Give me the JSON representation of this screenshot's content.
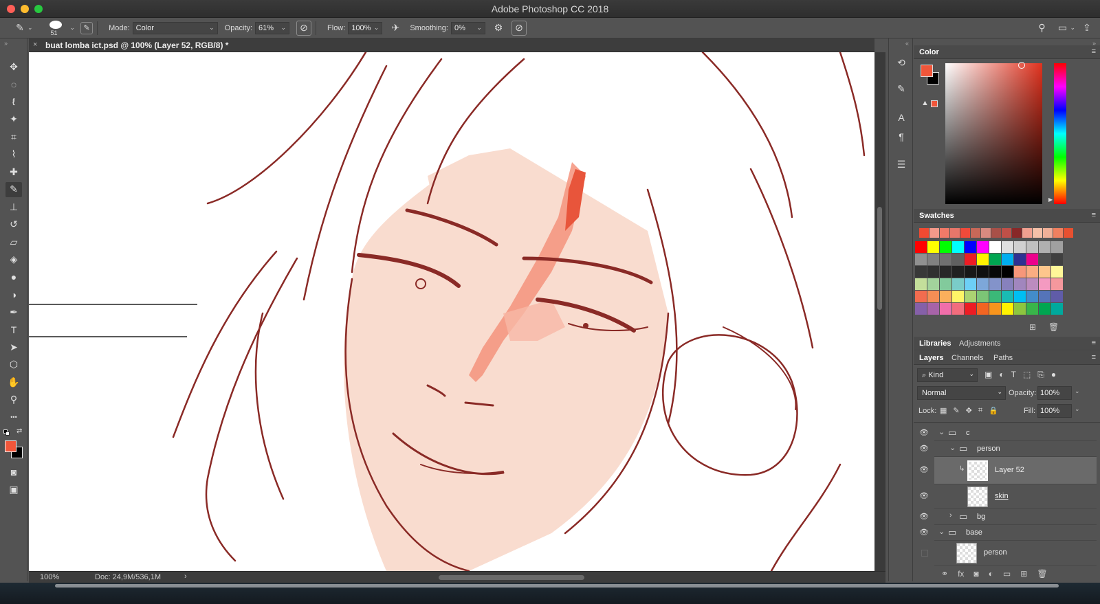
{
  "app": {
    "title": "Adobe Photoshop CC 2018",
    "traffic_lights": [
      "#ff5f57",
      "#febc2e",
      "#28c840"
    ]
  },
  "options_bar": {
    "brush_size": "51",
    "mode_label": "Mode:",
    "mode_value": "Color",
    "opacity_label": "Opacity:",
    "opacity_value": "61%",
    "flow_label": "Flow:",
    "flow_value": "100%",
    "smoothing_label": "Smoothing:",
    "smoothing_value": "0%"
  },
  "document": {
    "tab_title": "buat lomba ict.psd @ 100% (Layer 52, RGB/8) *",
    "close_glyph": "×"
  },
  "status_bar": {
    "zoom": "100%",
    "doc_info": "Doc: 24,9M/536,1M",
    "arrow": "›"
  },
  "tools": [
    {
      "name": "move-tool",
      "glyph": "✥"
    },
    {
      "name": "marquee-tool",
      "glyph": "◌"
    },
    {
      "name": "lasso-tool",
      "glyph": "ℓ"
    },
    {
      "name": "magic-wand-tool",
      "glyph": "✦"
    },
    {
      "name": "crop-tool",
      "glyph": "⌗"
    },
    {
      "name": "eyedropper-tool",
      "glyph": "⌇"
    },
    {
      "name": "healing-brush-tool",
      "glyph": "✚"
    },
    {
      "name": "brush-tool",
      "glyph": "✎"
    },
    {
      "name": "clone-stamp-tool",
      "glyph": "⊥"
    },
    {
      "name": "history-brush-tool",
      "glyph": "↺"
    },
    {
      "name": "eraser-tool",
      "glyph": "▱"
    },
    {
      "name": "paint-bucket-tool",
      "glyph": "◈"
    },
    {
      "name": "blur-tool",
      "glyph": "●"
    },
    {
      "name": "dodge-tool",
      "glyph": "◑"
    },
    {
      "name": "pen-tool",
      "glyph": "✒"
    },
    {
      "name": "type-tool",
      "glyph": "T"
    },
    {
      "name": "path-selection-tool",
      "glyph": "➤"
    },
    {
      "name": "shape-tool",
      "glyph": "⬡"
    },
    {
      "name": "hand-tool",
      "glyph": "✋"
    },
    {
      "name": "zoom-tool",
      "glyph": "⚲"
    },
    {
      "name": "more-tools",
      "glyph": "•••"
    }
  ],
  "colors": {
    "foreground": "#f0563a",
    "background": "#000000",
    "accent_panel_bg": "#535353"
  },
  "color_panel": {
    "title": "Color",
    "menu": "≡"
  },
  "swatches_panel": {
    "title": "Swatches",
    "recent": [
      "#f04a32",
      "#f59a8a",
      "#f07a68",
      "#e8766a",
      "#f04a3a",
      "#c86858",
      "#d88a80",
      "#a85048",
      "#c05048",
      "#882828",
      "#f0a090",
      "#f4c0a8",
      "#f0b098",
      "#f08060",
      "#e85030"
    ],
    "grid": [
      [
        "#ff0000",
        "#ffff00",
        "#00ff00",
        "#00ffff",
        "#0000ff",
        "#ff00ff",
        "#ffffff",
        "#e0e0e0",
        "#d0d0d0",
        "#c0c0c0",
        "#b0b0b0",
        "#a0a0a0"
      ],
      [
        "#909090",
        "#808080",
        "#707070",
        "#606060",
        "#ed1c24",
        "#fff200",
        "#00a651",
        "#00aeef",
        "#2e3192",
        "#ec008c",
        "#505050",
        "#404040"
      ],
      [
        "#383838",
        "#303030",
        "#282828",
        "#202020",
        "#181818",
        "#101010",
        "#080808",
        "#000000",
        "#f7977a",
        "#fbad82",
        "#fdc68c",
        "#fff799"
      ],
      [
        "#c4df9b",
        "#a3d39c",
        "#82ca9c",
        "#7accc8",
        "#6dcff6",
        "#7da7d9",
        "#8393ca",
        "#8781bd",
        "#a186be",
        "#bc8cbf",
        "#f49ac1",
        "#f5989d"
      ],
      [
        "#f26c4f",
        "#f68e55",
        "#fbaf5c",
        "#fff467",
        "#acd372",
        "#7cc576",
        "#3bb878",
        "#1abbb4",
        "#00bff3",
        "#438cca",
        "#5574b9",
        "#605ca8"
      ],
      [
        "#8560a8",
        "#a763a8",
        "#f06eaa",
        "#f26d7d",
        "#ed1c24",
        "#f26522",
        "#f7941d",
        "#fff200",
        "#8dc63f",
        "#39b54a",
        "#00a651",
        "#00a99d"
      ]
    ]
  },
  "libraries_tabs": [
    "Libraries",
    "Adjustments"
  ],
  "layers_tabs": [
    "Layers",
    "Channels",
    "Paths"
  ],
  "layers_panel": {
    "filter_label": "Kind",
    "blend_mode": "Normal",
    "opacity_label": "Opacity:",
    "opacity_value": "100%",
    "lock_label": "Lock:",
    "fill_label": "Fill:",
    "fill_value": "100%",
    "layers": [
      {
        "name": "c",
        "type": "group",
        "indent": 0,
        "expanded": true,
        "visible": true
      },
      {
        "name": "person",
        "type": "group",
        "indent": 1,
        "expanded": true,
        "visible": true
      },
      {
        "name": "Layer 52",
        "type": "layer",
        "indent": 2,
        "selected": true,
        "visible": true,
        "clipped": true
      },
      {
        "name": "skin",
        "type": "layer",
        "indent": 2,
        "visible": true
      },
      {
        "name": "bg",
        "type": "group",
        "indent": 1,
        "expanded": false,
        "visible": true
      },
      {
        "name": "base",
        "type": "group",
        "indent": 0,
        "expanded": true,
        "visible": true
      },
      {
        "name": "person",
        "type": "layer",
        "indent": 1,
        "visible": false
      }
    ]
  }
}
